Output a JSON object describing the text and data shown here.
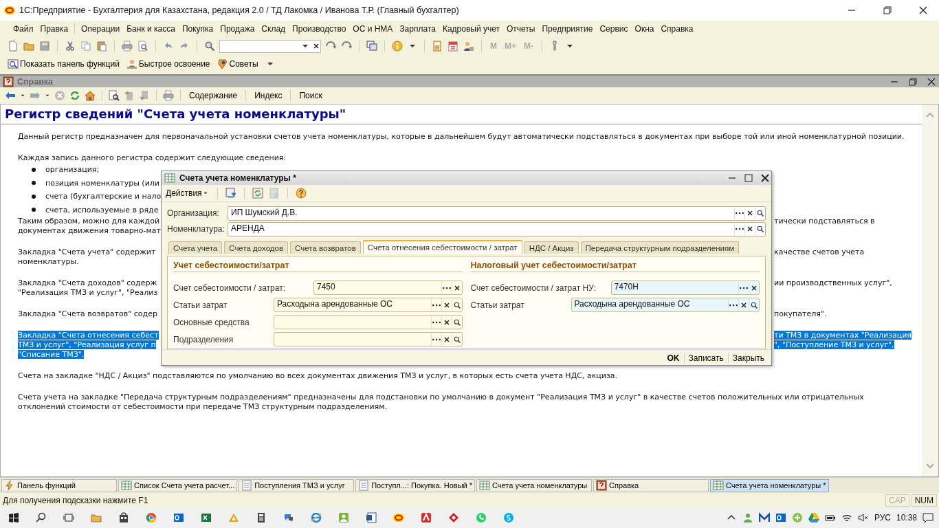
{
  "window": {
    "title": "1С:Предприятие - Бухгалтерия для Казахстана, редакция 2.0 / ТД Лакомка / Иванова Т.Р. (Главный бухгалтер)"
  },
  "menu": [
    "Файл",
    "Правка",
    "Операции",
    "Банк и касса",
    "Покупка",
    "Продажа",
    "Склад",
    "Производство",
    "ОС и НМА",
    "Зарплата",
    "Кадровый учет",
    "Отчеты",
    "Предприятие",
    "Сервис",
    "Окна",
    "Справка"
  ],
  "toolbar": {
    "memory_buttons": [
      "M",
      "M+",
      "M-"
    ]
  },
  "function_bar": [
    "Показать панель функций",
    "Быстрое освоение",
    "Советы"
  ],
  "help_window": {
    "title": "Справка",
    "toolbar_links": [
      "Содержание",
      "Индекс",
      "Поиск"
    ],
    "heading": "Регистр сведений \"Счета учета номенклатуры\"",
    "blocks": [
      {
        "kind": "para",
        "selected": false,
        "lines": [
          {
            "left": "Данный регистр предназначен для первоначальной установки счетов учета номенклатуры, которые в дальнейшем будут автоматически подставляться в документах при выборе той или иной номенклатурной позиции."
          }
        ]
      },
      {
        "kind": "para",
        "selected": false,
        "lines": [
          {
            "left": "Каждая запись данного регистра содержит следующие сведения:"
          }
        ]
      },
      {
        "kind": "bullet",
        "selected": false,
        "lines": [
          {
            "left": "организация;"
          }
        ]
      },
      {
        "kind": "bullet",
        "selected": false,
        "lines": [
          {
            "left": "позиция номенклатуры (или"
          }
        ]
      },
      {
        "kind": "bullet",
        "selected": false,
        "lines": [
          {
            "left": "счета (бухгалтерские и нало"
          }
        ]
      },
      {
        "kind": "bullet",
        "selected": false,
        "lines": [
          {
            "left": "счета, используемые в ряде"
          }
        ]
      },
      {
        "kind": "para",
        "selected": false,
        "lines": [
          {
            "left": "Таким образом, можно для каждой",
            "right": "тически подставляться в"
          },
          {
            "left": "документах движения товарно-мат"
          }
        ]
      },
      {
        "kind": "para",
        "selected": false,
        "lines": [
          {
            "left": "Закладка \"Счета учета\" содержит",
            "right": "качестве счетов учета"
          },
          {
            "left": "номенклатуры."
          }
        ]
      },
      {
        "kind": "para",
        "selected": false,
        "lines": [
          {
            "left": "Закладка \"Счета доходов\" содерж",
            "right": "ии производственных услуг\","
          },
          {
            "left": "\"Реализация ТМЗ и услуг\", \"Реализ"
          }
        ]
      },
      {
        "kind": "para",
        "selected": false,
        "lines": [
          {
            "left": "Закладка \"Счета возвратов\" содер",
            "right": "покупателя\"."
          }
        ]
      },
      {
        "kind": "para",
        "selected": true,
        "lines": [
          {
            "left": "Закладка \"Счета отнесения себест",
            "right": "ти ТМЗ в документах \"Реализация"
          },
          {
            "left": "ТМЗ и услуг\", \"Реализация услуг п",
            "right": "\", \"Поступление ТМЗ и услуг\","
          },
          {
            "left": "\"Списание ТМЗ\"."
          }
        ]
      },
      {
        "kind": "para",
        "selected": false,
        "lines": [
          {
            "left": "Счета на закладке \"НДС / Акциз\" подставляются по умолчанию во всех документах движения ТМЗ и услуг, в которых есть счета учета НДС, акциза."
          }
        ]
      },
      {
        "kind": "para",
        "selected": false,
        "lines": [
          {
            "left": "Счета учета на закладке \"Передача структурным подразделениям\" предназначены для подстановки по умолчанию в документ \"Реализация ТМЗ и услуг\" в качестве счетов положительных или отрицательных"
          },
          {
            "left": "отклонений стоимости от себестоимости при передаче ТМЗ структурным подразделениям."
          }
        ]
      }
    ]
  },
  "dialog": {
    "title": "Счета учета номенклатуры *",
    "actions_label": "Действия",
    "fields": [
      {
        "label": "Организация:",
        "value": "ИП Шумский Д.В."
      },
      {
        "label": "Номенклатура:",
        "value": "АРЕНДА"
      }
    ],
    "tabs": [
      {
        "label": "Счета учета",
        "selected": false
      },
      {
        "label": "Счета доходов",
        "selected": false
      },
      {
        "label": "Счета возвратов",
        "selected": false
      },
      {
        "label": "Счета отнесения себестоимости / затрат",
        "selected": true
      },
      {
        "label": "НДС / Акциз",
        "selected": false
      },
      {
        "label": "Передача структурным подразделениям",
        "selected": false
      }
    ],
    "sections": [
      {
        "title": "Учет себестоимости/затрат",
        "highlighted": false,
        "rows": [
          {
            "label": "Счет себестоимости / затрат:",
            "value": "7450",
            "search": false
          },
          {
            "label": "Статьи затрат",
            "value": "Расходына арендованные ОС",
            "search": true
          },
          {
            "label": "Основные средства",
            "search": true
          },
          {
            "label": "Подразделения",
            "search": true
          }
        ]
      },
      {
        "title": "Налоговый учет себестоимости/затрат",
        "highlighted": true,
        "rows": [
          {
            "label": "Счет себестоимости / затрат НУ:",
            "value": "7470Н",
            "search": false
          },
          {
            "label": "Статьи затрат",
            "value": "Расходына арендованные ОС",
            "search": true
          }
        ]
      }
    ],
    "buttons": [
      {
        "label": "OK",
        "default": true
      },
      {
        "label": "Записать",
        "default": false
      },
      {
        "label": "Закрыть",
        "default": false
      }
    ]
  },
  "window_tabs": [
    {
      "label": "Панель функций",
      "kind": "functions",
      "selected": false
    },
    {
      "label": "Список Счета учета расчет...",
      "kind": "table",
      "selected": false
    },
    {
      "label": "Поступления ТМЗ и услуг",
      "kind": "document",
      "selected": false
    },
    {
      "label": "Поступл...: Покупка. Новый *",
      "kind": "document",
      "selected": false
    },
    {
      "label": "Счета учета номенклатуры",
      "kind": "table",
      "selected": false
    },
    {
      "label": "Справка",
      "kind": "help",
      "selected": false
    },
    {
      "label": "Счета учета номенклатуры *",
      "kind": "table",
      "selected": true
    }
  ],
  "status_bar": {
    "hint": "Для получения подсказки нажмите F1",
    "indicators": [
      {
        "label": "CAP",
        "on": false
      },
      {
        "label": "NUM",
        "on": true
      }
    ]
  },
  "taskbar": {
    "language": "РУС",
    "time": "10:38"
  }
}
